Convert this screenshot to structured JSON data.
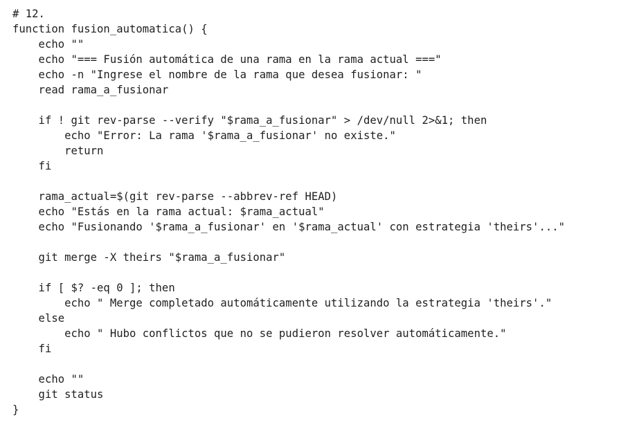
{
  "code": {
    "language": "bash",
    "lines": [
      "# 12.",
      "function fusion_automatica() {",
      "    echo \"\"",
      "    echo \"=== Fusión automática de una rama en la rama actual ===\"",
      "    echo -n \"Ingrese el nombre de la rama que desea fusionar: \"",
      "    read rama_a_fusionar",
      "",
      "    if ! git rev-parse --verify \"$rama_a_fusionar\" > /dev/null 2>&1; then",
      "        echo \"Error: La rama '$rama_a_fusionar' no existe.\"",
      "        return",
      "    fi",
      "",
      "    rama_actual=$(git rev-parse --abbrev-ref HEAD)",
      "    echo \"Estás en la rama actual: $rama_actual\"",
      "    echo \"Fusionando '$rama_a_fusionar' en '$rama_actual' con estrategia 'theirs'...\"",
      "",
      "    git merge -X theirs \"$rama_a_fusionar\"",
      "",
      "    if [ $? -eq 0 ]; then",
      "        echo \" Merge completado automáticamente utilizando la estrategia 'theirs'.\"",
      "    else",
      "        echo \" Hubo conflictos que no se pudieron resolver automáticamente.\"",
      "    fi",
      "",
      "    echo \"\"",
      "    git status",
      "}"
    ]
  },
  "colors": {
    "background": "#ffffff",
    "text": "#1f1f1f"
  }
}
